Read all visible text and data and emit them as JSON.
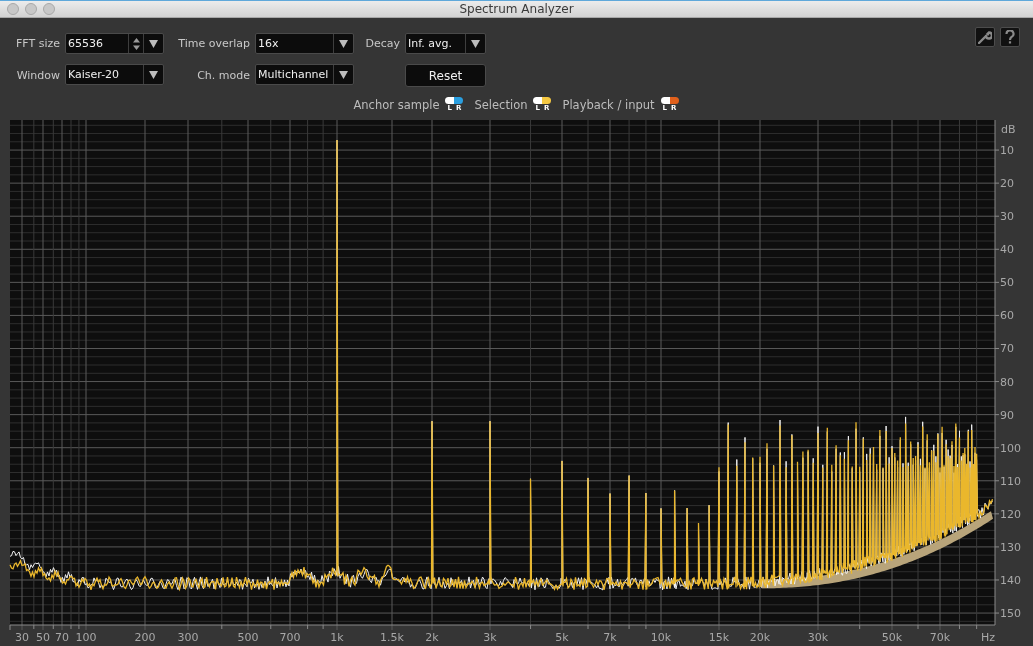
{
  "window": {
    "title": "Spectrum Analyzer"
  },
  "controls": [
    {
      "kind": "spinner",
      "label": "FFT size",
      "value": "65536"
    },
    {
      "kind": "dropdown",
      "label": "Time overlap",
      "value": "16x"
    },
    {
      "kind": "dropdown",
      "label": "Decay",
      "value": "Inf. avg."
    },
    {
      "kind": "dropdown",
      "label": "Window",
      "value": "Kaiser-20"
    },
    {
      "kind": "dropdown",
      "label": "Ch. mode",
      "value": "Multichannel"
    },
    {
      "kind": "button",
      "text": "Reset"
    }
  ],
  "legend": [
    {
      "label": "Anchor sample",
      "color": "#2a9fe0",
      "left": "L",
      "right": "R"
    },
    {
      "label": "Selection",
      "color": "#f5c842",
      "left": "L",
      "right": "R"
    },
    {
      "label": "Playback / input",
      "color": "#e0601c",
      "left": "L",
      "right": "R"
    }
  ],
  "spectrum": {
    "y_unit": "dB",
    "y_ticks": [
      "10",
      "20",
      "30",
      "40",
      "50",
      "60",
      "70",
      "80",
      "90",
      "100",
      "110",
      "120",
      "130",
      "140",
      "150"
    ],
    "x_ticks": [
      "30",
      "50",
      "70",
      "100",
      "200",
      "300",
      "500",
      "700",
      "1k",
      "1.5k",
      "2k",
      "3k",
      "5k",
      "7k",
      "10k",
      "15k",
      "20k",
      "30k",
      "50k",
      "70k"
    ],
    "x_unit": "Hz"
  }
}
